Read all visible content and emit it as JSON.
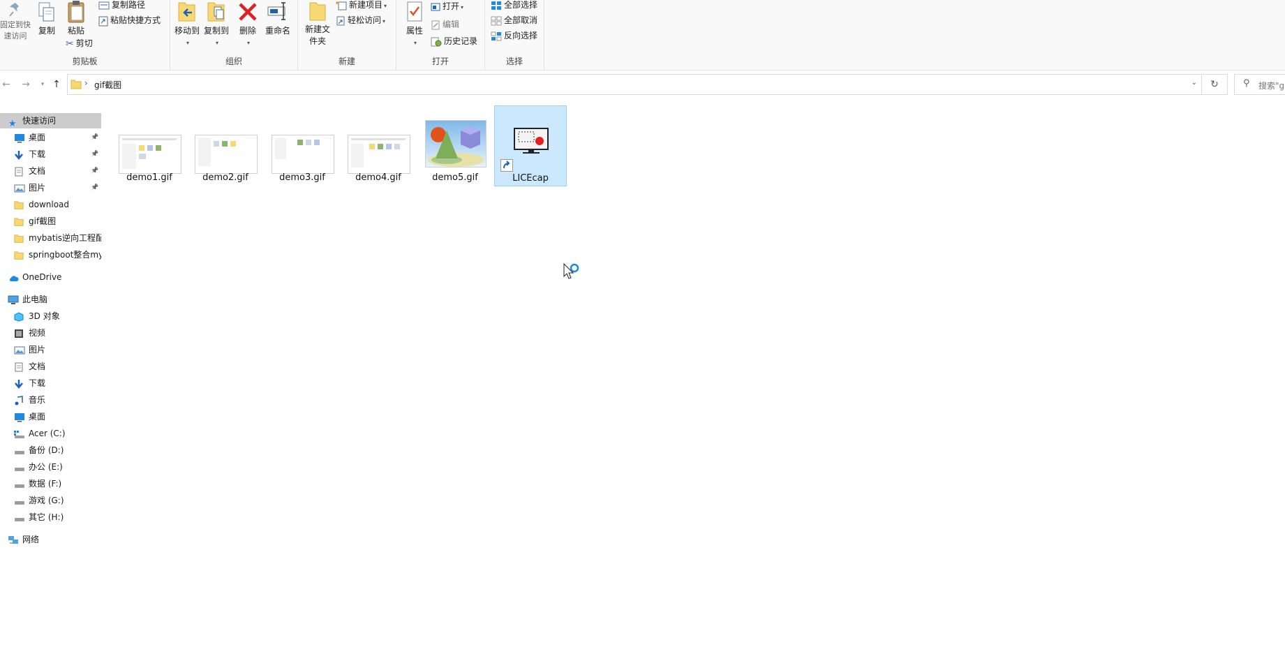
{
  "ribbon": {
    "clipboard": {
      "pin_label": "固定到快速访问",
      "copy_label": "复制",
      "paste_label": "粘贴",
      "copy_path_label": "复制路径",
      "paste_shortcut_label": "粘贴快捷方式",
      "cut_label": "剪切",
      "group_label": "剪贴板"
    },
    "organize": {
      "move_to_label": "移动到",
      "copy_to_label": "复制到",
      "delete_label": "删除",
      "rename_label": "重命名",
      "group_label": "组织"
    },
    "new": {
      "new_folder_label": "新建文件夹",
      "new_item_label": "新建项目",
      "easy_access_label": "轻松访问",
      "group_label": "新建"
    },
    "open": {
      "properties_label": "属性",
      "open_label": "打开",
      "edit_label": "编辑",
      "history_label": "历史记录",
      "group_label": "打开"
    },
    "select": {
      "select_all_label": "全部选择",
      "select_none_label": "全部取消",
      "invert_label": "反向选择",
      "group_label": "选择"
    }
  },
  "address": {
    "crumb_separator": "›",
    "current_folder": "gif截图",
    "search_placeholder": "搜索\"g"
  },
  "nav": {
    "quick_access": "快速访问",
    "quick_items": [
      {
        "label": "桌面",
        "pinned": true
      },
      {
        "label": "下载",
        "pinned": true
      },
      {
        "label": "文档",
        "pinned": true
      },
      {
        "label": "图片",
        "pinned": true
      },
      {
        "label": "download",
        "pinned": false
      },
      {
        "label": "gif截图",
        "pinned": false
      },
      {
        "label": "mybatis逆向工程配",
        "pinned": false
      },
      {
        "label": "springboot整合my",
        "pinned": false
      }
    ],
    "onedrive": "OneDrive",
    "this_pc": "此电脑",
    "pc_items": [
      {
        "label": "3D 对象"
      },
      {
        "label": "视频"
      },
      {
        "label": "图片"
      },
      {
        "label": "文档"
      },
      {
        "label": "下载"
      },
      {
        "label": "音乐"
      },
      {
        "label": "桌面"
      },
      {
        "label": "Acer (C:)"
      },
      {
        "label": "备份 (D:)"
      },
      {
        "label": "办公 (E:)"
      },
      {
        "label": "数据 (F:)"
      },
      {
        "label": "游戏 (G:)"
      },
      {
        "label": "其它 (H:)"
      }
    ],
    "network": "网络"
  },
  "files": [
    {
      "name": "demo1.gif",
      "kind": "screenshot-thumbnail"
    },
    {
      "name": "demo2.gif",
      "kind": "screenshot-thumbnail"
    },
    {
      "name": "demo3.gif",
      "kind": "screenshot-thumbnail"
    },
    {
      "name": "demo4.gif",
      "kind": "screenshot-thumbnail"
    },
    {
      "name": "demo5.gif",
      "kind": "image-thumbnail"
    },
    {
      "name": "LICEcap",
      "kind": "shortcut",
      "selected": true
    }
  ],
  "colors": {
    "selection_bg": "#cce8ff",
    "selection_border": "#99d1ff",
    "accent_blue": "#1e88e5",
    "folder_yellow": "#f8d775"
  }
}
